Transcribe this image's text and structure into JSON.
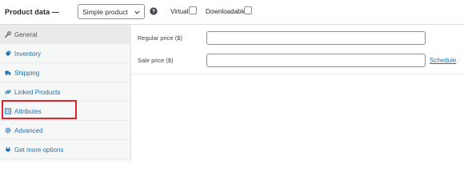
{
  "header": {
    "title": "Product data —",
    "product_type": "Simple product",
    "virtual_label": "Virtual:",
    "downloadable_label": "Downloadable:"
  },
  "sidebar": {
    "items": [
      {
        "label": "General",
        "icon": "wrench-icon",
        "active": true
      },
      {
        "label": "Inventory",
        "icon": "tag-icon",
        "active": false
      },
      {
        "label": "Shipping",
        "icon": "truck-icon",
        "active": false
      },
      {
        "label": "Linked Products",
        "icon": "link-icon",
        "active": false
      },
      {
        "label": "Attributes",
        "icon": "list-icon",
        "active": false
      },
      {
        "label": "Advanced",
        "icon": "gear-icon",
        "active": false
      },
      {
        "label": "Get more options",
        "icon": "plugin-icon",
        "active": false
      }
    ]
  },
  "general": {
    "regular_price_label": "Regular price ($)",
    "regular_price_value": "",
    "sale_price_label": "Sale price ($)",
    "sale_price_value": "",
    "schedule_link": "Schedule"
  },
  "colors": {
    "link": "#2271b1",
    "highlight": "#e3212b",
    "sidebar_bg": "#f6f7f7"
  }
}
